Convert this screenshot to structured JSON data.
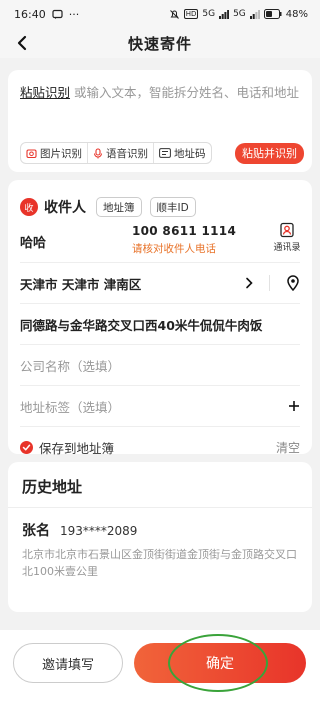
{
  "status_bar": {
    "time": "16:40",
    "msg_icon": "message-icon",
    "more": "···",
    "network_hd": "HD",
    "signal_5g_a": "5G",
    "signal_5g_b": "5G",
    "battery": "48%"
  },
  "nav": {
    "title": "快速寄件"
  },
  "paste": {
    "link_text": "粘贴识别",
    "placeholder": "或输入文本，智能拆分姓名、电话和地址",
    "tools": [
      {
        "label": "图片识别",
        "icon": "image-icon"
      },
      {
        "label": "语音识别",
        "icon": "microphone-icon"
      },
      {
        "label": "地址码",
        "icon": "address-code-icon"
      }
    ],
    "submit": "粘贴并识别"
  },
  "recipient": {
    "badge": "收",
    "label": "收件人",
    "address_book": "地址簿",
    "sf_id": "顺丰ID",
    "name": "哈哈",
    "phone": "100 8611 1114",
    "phone_warning": "请核对收件人电话",
    "contacts": "通讯录",
    "region": "天津市 天津市 津南区",
    "detail_address": "同德路与金华路交叉口西40米牛侃侃牛肉饭",
    "company_placeholder": "公司名称（选填）",
    "tag_placeholder": "地址标签（选填）",
    "save_to_book": "保存到地址簿",
    "clear": "清空"
  },
  "history": {
    "title": "历史地址",
    "entries": [
      {
        "name": "张名",
        "phone": "193****2089",
        "address": "北京市北京市石景山区金顶街街道金顶街与金顶路交叉口北100米壹公里"
      }
    ]
  },
  "bottom": {
    "invite": "邀请填写",
    "confirm": "确定"
  },
  "colors": {
    "accent": "#e8342a",
    "warning": "#e8732a",
    "highlight_ring": "#3aa33a"
  }
}
